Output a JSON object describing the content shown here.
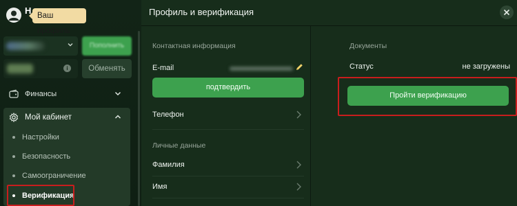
{
  "profile": {
    "initial": "Н",
    "tooltip": "Ваш профиль"
  },
  "sidebar": {
    "deposit_label": "Пополнить",
    "exchange_label": "Обменять",
    "finance_label": "Финансы",
    "cabinet_label": "Мой кабинет",
    "cabinet_items": [
      {
        "label": "Настройки"
      },
      {
        "label": "Безопасность"
      },
      {
        "label": "Самоограничение"
      },
      {
        "label": "Верификация",
        "active": true
      }
    ]
  },
  "main": {
    "title": "Профиль и верификация",
    "contact": {
      "heading": "Контактная информация",
      "email_label": "E-mail",
      "confirm_label": "подтвердить",
      "phone_label": "Телефон"
    },
    "personal": {
      "heading": "Личные данные",
      "surname_label": "Фамилия",
      "name_label": "Имя"
    },
    "documents": {
      "heading": "Документы",
      "status_label": "Статус",
      "status_value": "не загружены",
      "verify_label": "Пройти верификацию"
    }
  },
  "icons": {
    "avatar": "user-avatar-icon",
    "finance": "wallet-icon",
    "cabinet": "gear-icon",
    "close": "close-icon",
    "edit": "pencil-icon",
    "chevron": "chevron-right-icon"
  },
  "colors": {
    "accent_green": "#3da14e",
    "tooltip_bg": "#f2dba3",
    "highlight_red": "#c91d1d",
    "panel_bg": "#172d1b"
  }
}
